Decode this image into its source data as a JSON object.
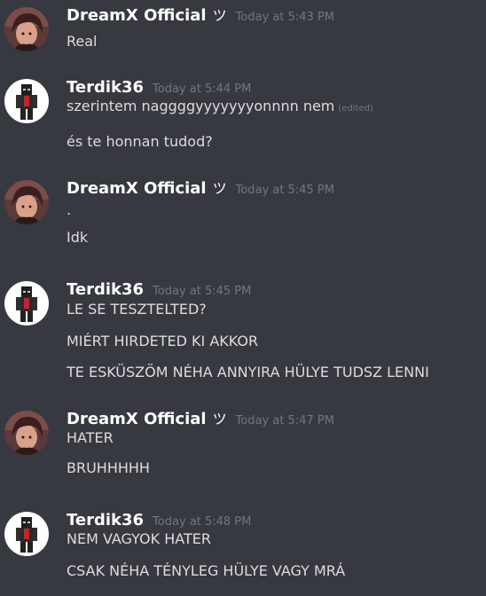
{
  "messages": [
    {
      "author": "DreamX Official",
      "tag": "ツ",
      "timestamp": "Today at 5:43 PM",
      "avatar": "anime-portrait",
      "lines": [
        {
          "text": "Real"
        }
      ]
    },
    {
      "author": "Terdik36",
      "tag": "",
      "timestamp": "Today at 5:44 PM",
      "avatar": "minecraft-skin",
      "lines": [
        {
          "text": "szerintem naggggyyyyyyyonnnn nem",
          "edited": "(edited)"
        },
        {
          "text": "és te honnan tudod?"
        }
      ]
    },
    {
      "author": "DreamX Official",
      "tag": "ツ",
      "timestamp": "Today at 5:45 PM",
      "avatar": "anime-portrait",
      "lines": [
        {
          "text": "."
        },
        {
          "text": "Idk"
        }
      ]
    },
    {
      "author": "Terdik36",
      "tag": "",
      "timestamp": "Today at 5:45 PM",
      "avatar": "minecraft-skin",
      "lines": [
        {
          "text": "LE SE TESZTELTED?"
        },
        {
          "text": "MIÉRT HIRDETED KI AKKOR"
        },
        {
          "text": "TE ESKÜSZÖM NÉHA ANNYIRA HÜLYE TUDSZ LENNI"
        }
      ]
    },
    {
      "author": "DreamX Official",
      "tag": "ツ",
      "timestamp": "Today at 5:47 PM",
      "avatar": "anime-portrait",
      "lines": [
        {
          "text": "HATER"
        },
        {
          "text": "BRUHHHHH"
        }
      ]
    },
    {
      "author": "Terdik36",
      "tag": "",
      "timestamp": "Today at 5:48 PM",
      "avatar": "minecraft-skin",
      "lines": [
        {
          "text": "NEM VAGYOK HATER"
        },
        {
          "text": "CSAK NÉHA TÉNYLEG HÜLYE VAGY MRÁ"
        }
      ]
    }
  ],
  "colors": {
    "background": "#36393f",
    "username": "#ffffff",
    "message_text": "#dcddde",
    "muted": "#72767d"
  }
}
